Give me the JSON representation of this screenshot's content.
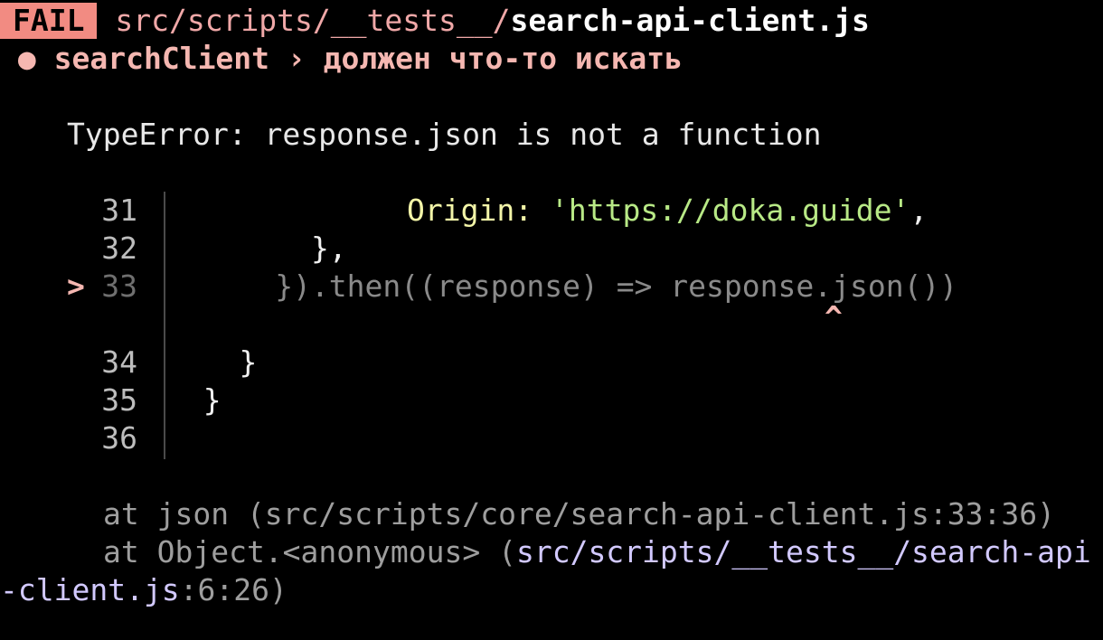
{
  "header": {
    "status_badge": "FAIL",
    "path_prefix": "src/scripts/__tests__/",
    "file_name": "search-api-client.js"
  },
  "test": {
    "bullet": "●",
    "suite": "searchClient",
    "separator": "›",
    "name": "должен что-то искать"
  },
  "error": {
    "message": "TypeError: response.json is not a function"
  },
  "code_frame": {
    "marker": ">",
    "caret": "^",
    "lines": [
      {
        "num": "31",
        "code_indent": "         ",
        "key": "Origin: ",
        "string": "'https://doka.guide'",
        "tail": ","
      },
      {
        "num": "32",
        "code": "        },"
      },
      {
        "num": "33",
        "code": "      }).then((response) => response.json())"
      },
      {
        "num": "34",
        "code": "    }"
      },
      {
        "num": "35",
        "code": "  }"
      },
      {
        "num": "36",
        "code": ""
      }
    ]
  },
  "stack": {
    "line1": "at json (src/scripts/core/search-api-client.js:33:36)",
    "line2_prefix": "at Object.<anonymous> (",
    "line2_link": "src/scripts/__tests__/search-api",
    "line3_link": "-client.js",
    "line3_suffix": ":6:26)"
  }
}
